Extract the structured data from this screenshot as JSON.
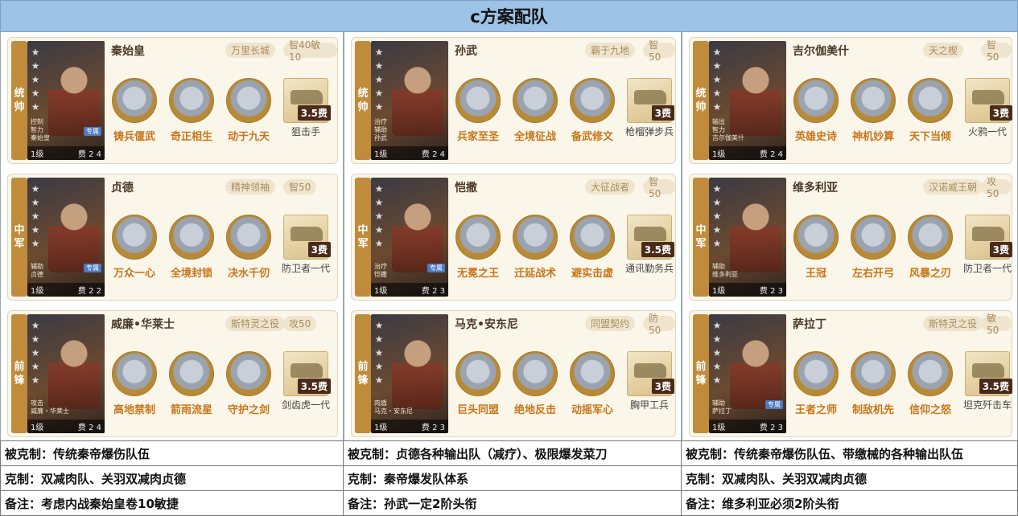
{
  "title": "c方案配队",
  "columns": [
    {
      "cards": [
        {
          "role": [
            "统",
            "帅"
          ],
          "name": "秦始皇",
          "tags": [
            "万里长城",
            "智40敏10"
          ],
          "portrait": {
            "attrs": [
              "控制",
              "智力",
              "秦始皇"
            ],
            "spec": "专属",
            "level": "1级",
            "cost": "费 2",
            "stars": "4"
          },
          "skills": [
            "铸兵偃武",
            "奇正相生",
            "动于九天"
          ],
          "equip": {
            "cost": "3.5费",
            "label": "狙击手"
          }
        },
        {
          "role": [
            "中",
            "军"
          ],
          "name": "贞德",
          "tags": [
            "精神领袖",
            "智50"
          ],
          "portrait": {
            "attrs": [
              "辅助",
              "贞德"
            ],
            "spec": "专属",
            "level": "1级",
            "cost": "费 2",
            "stars": "2"
          },
          "skills": [
            "万众一心",
            "全境封锁",
            "决水千仞"
          ],
          "equip": {
            "cost": "3费",
            "label": "防卫者一代"
          }
        },
        {
          "role": [
            "前",
            "锋"
          ],
          "name": "威廉•华莱士",
          "tags": [
            "斯特灵之役",
            "攻50"
          ],
          "portrait": {
            "attrs": [
              "攻击",
              "威廉・华莱士"
            ],
            "spec": "",
            "level": "1级",
            "cost": "费 2",
            "stars": "4"
          },
          "skills": [
            "高地禁制",
            "箭雨流星",
            "守护之剑"
          ],
          "equip": {
            "cost": "3.5费",
            "label": "剑齿虎一代"
          }
        }
      ]
    },
    {
      "cards": [
        {
          "role": [
            "统",
            "帅"
          ],
          "name": "孙武",
          "tags": [
            "霸于九地",
            "智50"
          ],
          "portrait": {
            "attrs": [
              "治疗",
              "辅助",
              "孙武"
            ],
            "spec": "",
            "level": "1级",
            "cost": "费 2",
            "stars": "4"
          },
          "skills": [
            "兵家至圣",
            "全境征战",
            "备武修文"
          ],
          "equip": {
            "cost": "3费",
            "label": "枪榴弹步兵"
          }
        },
        {
          "role": [
            "中",
            "军"
          ],
          "name": "恺撒",
          "tags": [
            "大征战者",
            "智50"
          ],
          "portrait": {
            "attrs": [
              "治疗",
              "恺撒"
            ],
            "spec": "专属",
            "level": "1级",
            "cost": "费 2",
            "stars": "3"
          },
          "skills": [
            "无冕之王",
            "迁延战术",
            "避实击虚"
          ],
          "equip": {
            "cost": "3.5费",
            "label": "通讯勤务兵"
          }
        },
        {
          "role": [
            "前",
            "锋"
          ],
          "name": "马克•安东尼",
          "tags": [
            "同盟契约",
            "防50"
          ],
          "portrait": {
            "attrs": [
              "肉盾",
              "马克・安东尼"
            ],
            "spec": "",
            "level": "1级",
            "cost": "费 2",
            "stars": "3"
          },
          "skills": [
            "巨头同盟",
            "绝地反击",
            "动摇军心"
          ],
          "equip": {
            "cost": "3费",
            "label": "胸甲工兵"
          }
        }
      ]
    },
    {
      "cards": [
        {
          "role": [
            "统",
            "帅"
          ],
          "name": "吉尔伽美什",
          "tags": [
            "天之楔",
            "智50"
          ],
          "portrait": {
            "attrs": [
              "输出",
              "智力",
              "吉尔伽美什"
            ],
            "spec": "",
            "level": "1级",
            "cost": "费 2",
            "stars": "4"
          },
          "skills": [
            "英雄史诗",
            "神机妙算",
            "天下当倾"
          ],
          "equip": {
            "cost": "3费",
            "label": "火鸦一代"
          }
        },
        {
          "role": [
            "中",
            "军"
          ],
          "name": "维多利亚",
          "tags": [
            "汉诺威王朝",
            "攻50"
          ],
          "portrait": {
            "attrs": [
              "辅助",
              "维多利亚"
            ],
            "spec": "",
            "level": "1级",
            "cost": "费 2",
            "stars": "3"
          },
          "skills": [
            "王冠",
            "左右开弓",
            "风暴之刃"
          ],
          "equip": {
            "cost": "3费",
            "label": "防卫者一代"
          }
        },
        {
          "role": [
            "前",
            "锋"
          ],
          "name": "萨拉丁",
          "tags": [
            "斯特灵之役",
            "敏50"
          ],
          "portrait": {
            "attrs": [
              "辅助",
              "萨拉丁"
            ],
            "spec": "专属",
            "level": "1级",
            "cost": "费 2",
            "stars": "3"
          },
          "skills": [
            "王者之师",
            "制敌机先",
            "信仰之怒"
          ],
          "equip": {
            "cost": "3.5费",
            "label": "坦克歼击车"
          }
        }
      ]
    }
  ],
  "rows": [
    [
      "被克制：传统秦帝爆伤队伍",
      "被克制：贞德各种输出队（减疗）、极限爆发菜刀",
      "被克制：传统秦帝爆伤队伍、带缴械的各种输出队伍"
    ],
    [
      "克制：双减肉队、关羽双减肉贞德",
      "克制：秦帝爆发队体系",
      "克制：双减肉队、关羽双减肉贞德"
    ],
    [
      "备注：考虑内战秦始皇卷10敏捷",
      "备注：孙武一定2阶头衔",
      "备注：维多利亚必须2阶头衔"
    ]
  ]
}
